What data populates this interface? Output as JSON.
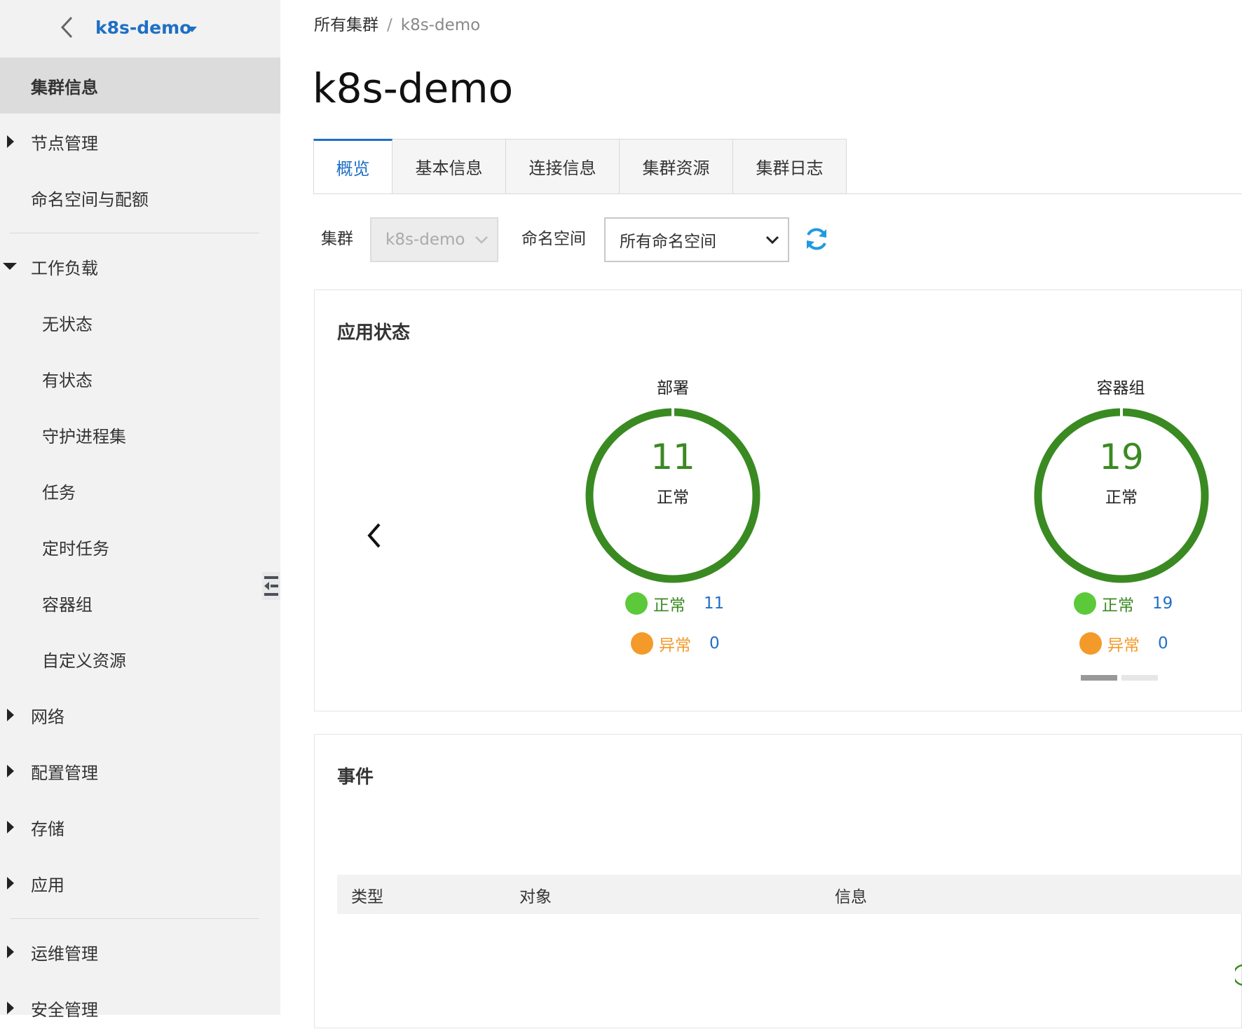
{
  "sidebar": {
    "cluster_name": "k8s-demo",
    "items": [
      {
        "label": "集群信息"
      },
      {
        "label": "节点管理"
      },
      {
        "label": "命名空间与配额"
      },
      {
        "label": "工作负载"
      },
      {
        "label": "无状态"
      },
      {
        "label": "有状态"
      },
      {
        "label": "守护进程集"
      },
      {
        "label": "任务"
      },
      {
        "label": "定时任务"
      },
      {
        "label": "容器组"
      },
      {
        "label": "自定义资源"
      },
      {
        "label": "网络"
      },
      {
        "label": "配置管理"
      },
      {
        "label": "存储"
      },
      {
        "label": "应用"
      },
      {
        "label": "运维管理"
      },
      {
        "label": "安全管理"
      }
    ]
  },
  "breadcrumb": {
    "root": "所有集群",
    "separator": "/",
    "current": "k8s-demo"
  },
  "page_title": "k8s-demo",
  "tabs": [
    {
      "label": "概览"
    },
    {
      "label": "基本信息"
    },
    {
      "label": "连接信息"
    },
    {
      "label": "集群资源"
    },
    {
      "label": "集群日志"
    }
  ],
  "filters": {
    "cluster_label": "集群",
    "cluster_value": "k8s-demo",
    "namespace_label": "命名空间",
    "namespace_value": "所有命名空间"
  },
  "app_status": {
    "title": "应用状态",
    "rings": [
      {
        "title": "部署",
        "count": "11",
        "state": "正常",
        "normal_label": "正常",
        "normal_value": "11",
        "abnormal_label": "异常",
        "abnormal_value": "0"
      },
      {
        "title": "容器组",
        "count": "19",
        "state": "正常",
        "normal_label": "正常",
        "normal_value": "19",
        "abnormal_label": "异常",
        "abnormal_value": "0"
      }
    ]
  },
  "events": {
    "title": "事件",
    "columns": [
      "类型",
      "对象",
      "信息"
    ]
  },
  "colors": {
    "accent": "#1f6fc5",
    "ring_green": "#3a8a22",
    "normal_dot": "#5cc93a",
    "abnormal_dot": "#f39a2b"
  }
}
